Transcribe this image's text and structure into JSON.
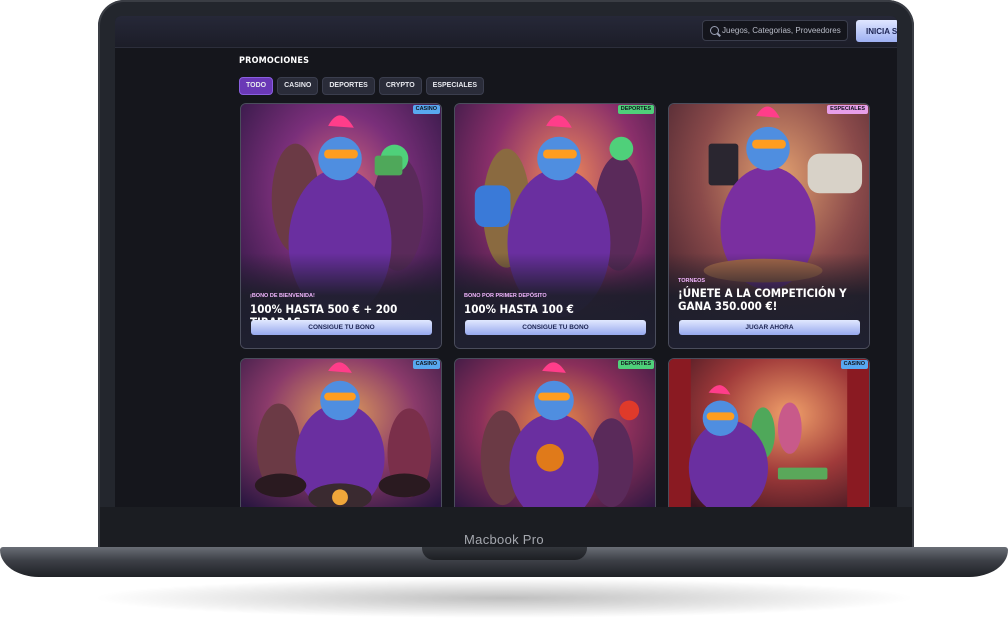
{
  "device": {
    "brand_label": "Macbook Pro"
  },
  "header": {
    "search_placeholder": "Juegos, Categorias, Proveedores",
    "login_label": "INICIA S"
  },
  "page": {
    "title": "PROMOCIONES"
  },
  "filters": [
    {
      "label": "TODO",
      "active": true
    },
    {
      "label": "CASINO",
      "active": false
    },
    {
      "label": "DEPORTES",
      "active": false
    },
    {
      "label": "CRYPTO",
      "active": false
    },
    {
      "label": "ESPECIALES",
      "active": false
    }
  ],
  "promos": [
    {
      "tag": "CASINO",
      "kicker": "¡BONO DE BIENVENIDA!",
      "headline": "100% HASTA 500 € + 200 TIRADAS",
      "cta": "CONSIGUE TU BONO"
    },
    {
      "tag": "DEPORTES",
      "kicker": "BONO POR PRIMER DEPÓSITO",
      "headline": "100% HASTA 100 €",
      "cta": "CONSIGUE TU BONO"
    },
    {
      "tag": "ESPECIALES",
      "kicker": "TORNEOS",
      "headline": "¡ÚNETE A LA COMPETICIÓN Y GANA 350.000 €!",
      "cta": "JUGAR AHORA"
    },
    {
      "tag": "CASINO"
    },
    {
      "tag": "DEPORTES"
    },
    {
      "tag": "CASINO"
    }
  ],
  "colors": {
    "accent": "#6a38b6",
    "casino": "#58a8f0",
    "deportes": "#4fd07a",
    "especiales": "#e79ee9"
  }
}
